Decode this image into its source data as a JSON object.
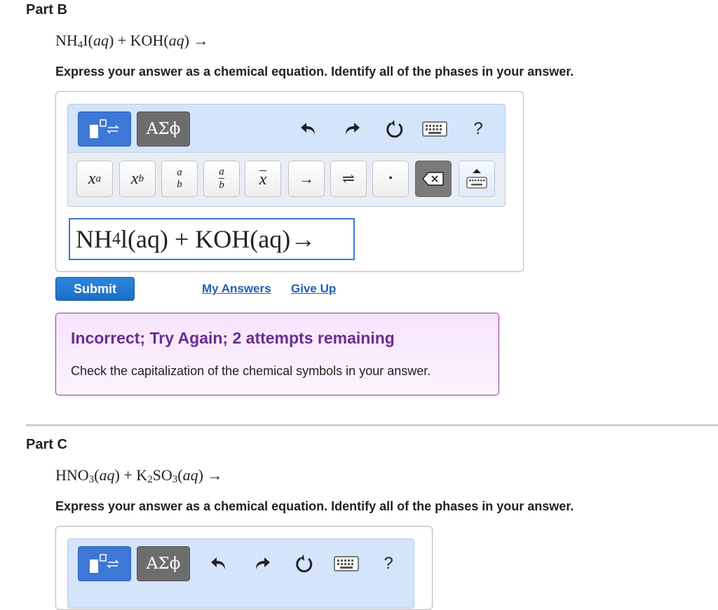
{
  "part_b": {
    "title": "Part B",
    "equation": {
      "a": "NH",
      "a_sub": "4",
      "b": "I(",
      "b_phase": "aq",
      "c": ") + KOH(",
      "c_phase": "aq",
      "d": ") →"
    },
    "instruction": "Express your answer as a chemical equation. Identify all of the phases in your answer.",
    "toolbar": {
      "greek_label": "ΑΣϕ",
      "help_label": "?",
      "icons": [
        "templates-icon",
        "greek-letters-icon",
        "undo-icon",
        "redo-icon",
        "reset-icon",
        "keyboard-shortcuts-icon",
        "help-icon"
      ]
    },
    "keys": {
      "superscript_base": "x",
      "superscript_exp": "a",
      "subscript_base": "x",
      "subscript_sub": "b",
      "frac_num": "a",
      "frac_den": "b",
      "mixed_num": "a",
      "mixed_den": "b",
      "overline_x": "x",
      "arrow": "→",
      "equilibrium": "⇌",
      "dot": "•",
      "delete_icon": "backspace-icon",
      "keyboard_icon": "keyboard-icon"
    },
    "answer": {
      "a": "NH",
      "a_sub": "4",
      "b": "l(aq)",
      "c": " + ",
      "d": "KOH(aq)→"
    },
    "submit_label": "Submit",
    "my_answers_label": "My Answers",
    "give_up_label": "Give Up",
    "feedback": {
      "title": "Incorrect; Try Again; 2 attempts remaining",
      "message": "Check the capitalization of the chemical symbols in your answer."
    }
  },
  "part_c": {
    "title": "Part C",
    "equation": {
      "a": "HNO",
      "a_sub": "3",
      "b": "(",
      "b_phase": "aq",
      "c": ") + K",
      "c_sub": "2",
      "d": "SO",
      "d_sub": "3",
      "e": "(",
      "e_phase": "aq",
      "f": ") →"
    },
    "instruction": "Express your answer as a chemical equation. Identify all of the phases in your answer.",
    "toolbar": {
      "greek_label": "ΑΣϕ",
      "help_label": "?"
    }
  },
  "colors": {
    "accent_blue": "#3d78d6",
    "submit_blue": "#1b6ec6",
    "link_blue": "#1f5fb3",
    "feedback_purple": "#6b2c91",
    "feedback_border": "#8a3d9c",
    "editor_bg": "#d3e4fb"
  }
}
